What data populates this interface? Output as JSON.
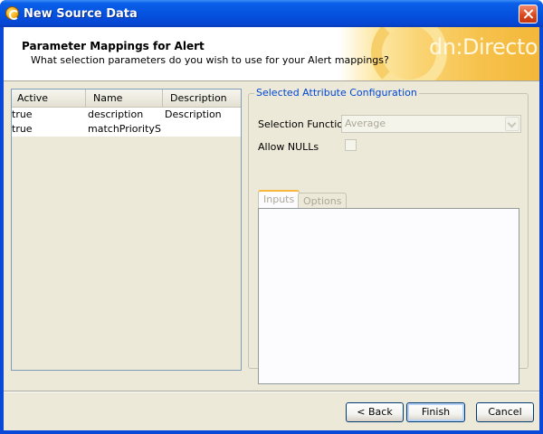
{
  "window": {
    "title": "New Source Data"
  },
  "header": {
    "title": "Parameter Mappings for Alert",
    "subtitle": "What selection parameters do you wish to use for your Alert mappings?",
    "logo_text": "dn:Director"
  },
  "mappings_table": {
    "columns": [
      "Active",
      "Name",
      "Description"
    ],
    "rows": [
      {
        "active": "true",
        "name": "description",
        "description": "Description"
      },
      {
        "active": "true",
        "name": "matchPriorityS...",
        "description": ""
      }
    ]
  },
  "config": {
    "legend": "Selected Attribute Configuration",
    "selection_function_label": "Selection Function",
    "selection_function_value": "Average",
    "allow_nulls_label": "Allow NULLs",
    "allow_nulls_checked": false,
    "tabs": [
      "Inputs",
      "Options"
    ],
    "active_tab": "Inputs"
  },
  "buttons": {
    "back": "< Back",
    "finish": "Finish",
    "cancel": "Cancel"
  },
  "colors": {
    "title_bar": "#0553e0",
    "legend_text": "#0046d5",
    "dialog_bg": "#ece9d8"
  },
  "icons": {
    "app": "wizard-app-icon",
    "close": "close-icon",
    "dropdown": "chevron-down-icon"
  }
}
